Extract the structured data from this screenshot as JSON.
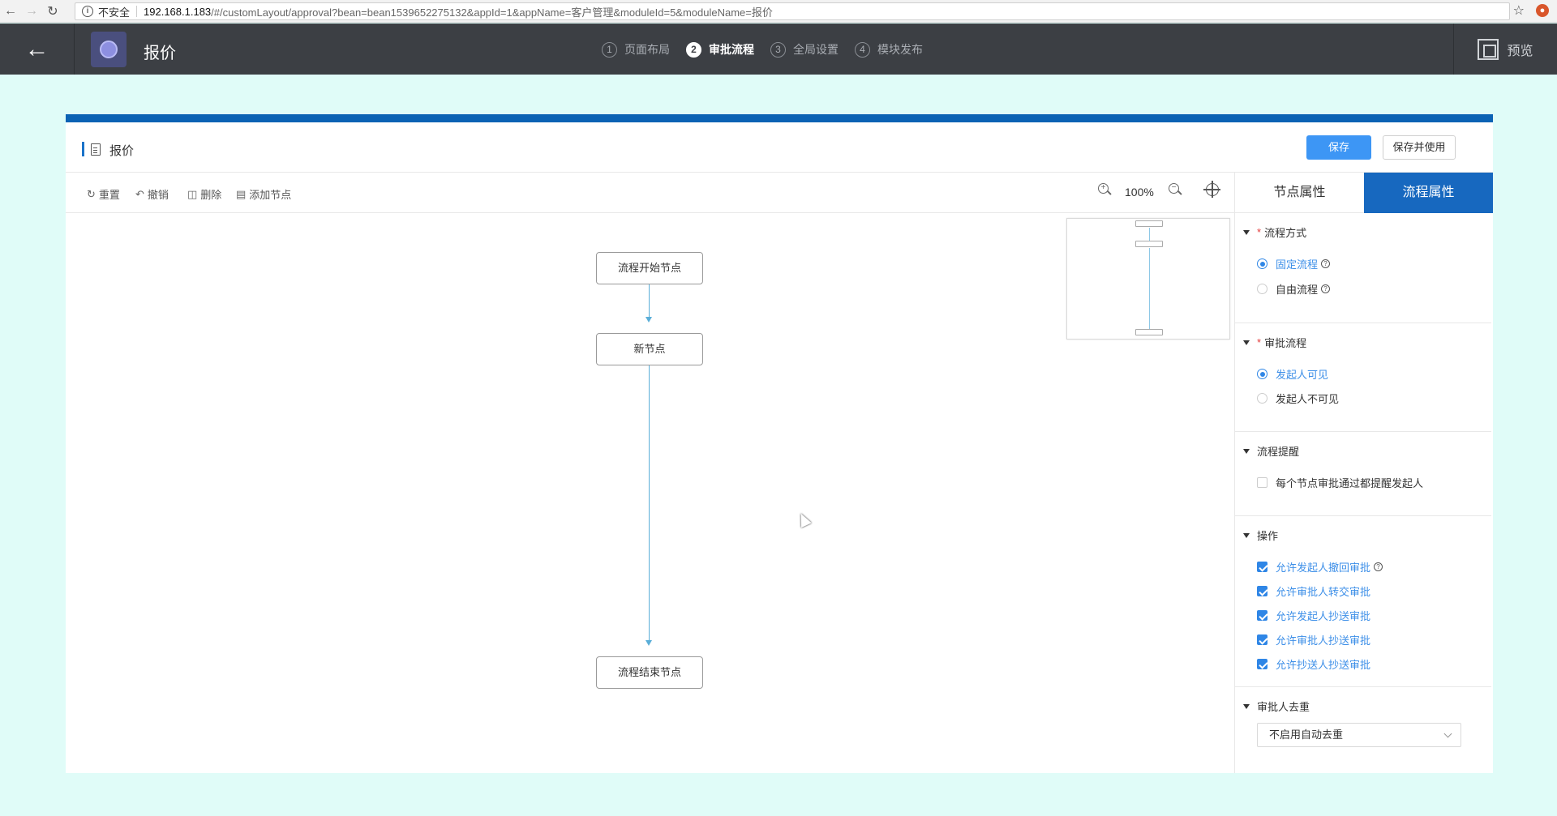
{
  "browser": {
    "not_secure": "不安全",
    "url_host": "192.168.1.183",
    "url_rest": "/#/customLayout/approval?bean=bean1539652275132&appId=1&appName=客户管理&moduleId=5&moduleName=报价"
  },
  "header": {
    "app_title": "报价",
    "steps": [
      {
        "num": "1",
        "label": "页面布局"
      },
      {
        "num": "2",
        "label": "审批流程"
      },
      {
        "num": "3",
        "label": "全局设置"
      },
      {
        "num": "4",
        "label": "模块发布"
      }
    ],
    "preview_label": "预览"
  },
  "card": {
    "title": "报价",
    "save_label": "保存",
    "save_use_label": "保存并使用"
  },
  "toolbar": {
    "reset": "重置",
    "undo": "撤销",
    "delete": "删除",
    "add_node": "添加节点",
    "zoom": "100%"
  },
  "flow": {
    "start_node": "流程开始节点",
    "new_node": "新节点",
    "end_node": "流程结束节点"
  },
  "panel": {
    "tabs": [
      "节点属性",
      "流程属性"
    ],
    "mode": {
      "title": "流程方式",
      "options": [
        "固定流程",
        "自由流程"
      ]
    },
    "approval": {
      "title": "审批流程",
      "options": [
        "发起人可见",
        "发起人不可见"
      ]
    },
    "reminder": {
      "title": "流程提醒",
      "option": "每个节点审批通过都提醒发起人"
    },
    "operation": {
      "title": "操作",
      "options": [
        "允许发起人撤回审批",
        "允许审批人转交审批",
        "允许发起人抄送审批",
        "允许审批人抄送审批",
        "允许抄送人抄送审批"
      ]
    },
    "dedupe": {
      "title": "审批人去重",
      "value": "不启用自动去重"
    }
  }
}
